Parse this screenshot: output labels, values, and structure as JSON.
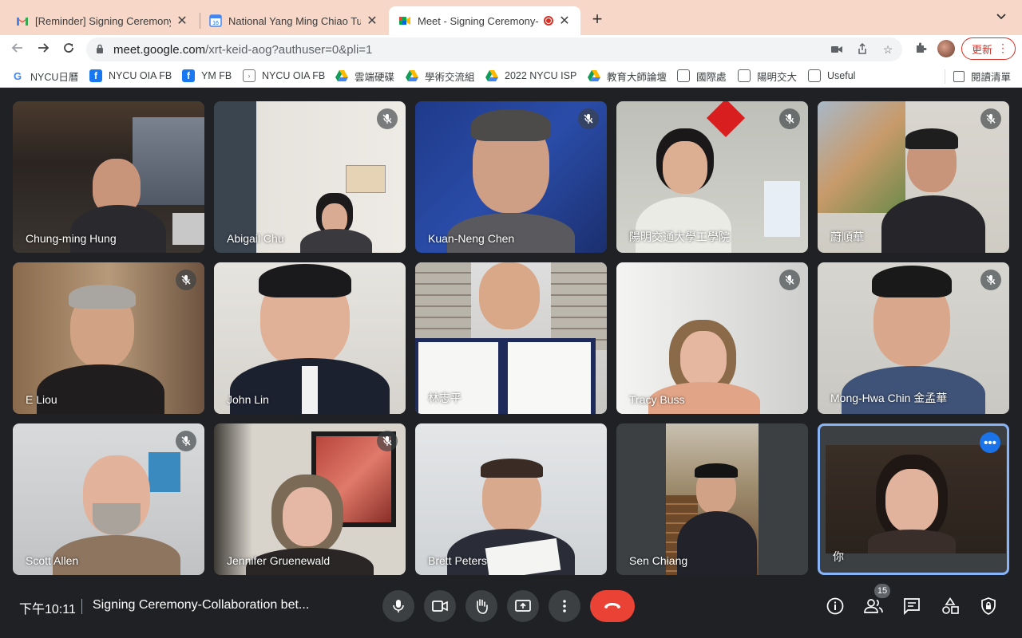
{
  "tabs": [
    {
      "title": "[Reminder] Signing Ceremony-",
      "favicon": "gmail-icon"
    },
    {
      "title": "National Yang Ming Chiao Tung",
      "favicon": "calendar-icon"
    },
    {
      "title": "Meet - Signing Ceremony-",
      "favicon": "meet-icon",
      "recording": true
    }
  ],
  "toolbar": {
    "url_host": "meet.google.com",
    "url_rest": "/xrt-keid-aog?authuser=0&pli=1",
    "update_label": "更新"
  },
  "bookmarks": [
    {
      "label": "NYCU日曆",
      "icon": "google-icon"
    },
    {
      "label": "NYCU OIA FB",
      "icon": "facebook-icon"
    },
    {
      "label": "YM FB",
      "icon": "facebook-icon"
    },
    {
      "label": "NYCU OIA FB",
      "icon": "arrow-circle-icon"
    },
    {
      "label": "雲端硬碟",
      "icon": "drive-icon"
    },
    {
      "label": "學術交流組",
      "icon": "drive-icon"
    },
    {
      "label": "2022 NYCU ISP",
      "icon": "drive-icon"
    },
    {
      "label": "教育大師論壇",
      "icon": "drive-icon"
    },
    {
      "label": "國際處",
      "icon": "folder-icon"
    },
    {
      "label": "陽明交大",
      "icon": "folder-icon"
    },
    {
      "label": "Useful",
      "icon": "folder-icon"
    }
  ],
  "reading_list": "閱讀清單",
  "participants": [
    {
      "name": "Chung-ming Hung",
      "muted": false
    },
    {
      "name": "Abigail Chu",
      "muted": true
    },
    {
      "name": "Kuan-Neng Chen",
      "muted": true
    },
    {
      "name": "陽明交通大學工學院",
      "muted": true
    },
    {
      "name": "蔚順華",
      "muted": true
    },
    {
      "name": "E Liou",
      "muted": true
    },
    {
      "name": "John Lin",
      "muted": false
    },
    {
      "name": "林志平",
      "muted": false
    },
    {
      "name": "Tracy Buss",
      "muted": true
    },
    {
      "name": "Mong-Hwa Chin 金孟華",
      "muted": true
    },
    {
      "name": "Scott Allen",
      "muted": true
    },
    {
      "name": "Jennifer Gruenewald",
      "muted": true
    },
    {
      "name": "Brett Peters",
      "muted": false
    },
    {
      "name": "Sen Chiang",
      "muted": false
    },
    {
      "name": "你",
      "muted": false,
      "self": true
    }
  ],
  "bottombar": {
    "time": "下午10:11",
    "meeting_title": "Signing Ceremony-Collaboration bet...",
    "participant_count": "15"
  },
  "colors": {
    "background": "#202124",
    "tabstrip": "#f6d7c8",
    "hangup": "#ea4335",
    "self_border": "#8ab4f8",
    "accent_blue": "#1a73e8"
  }
}
